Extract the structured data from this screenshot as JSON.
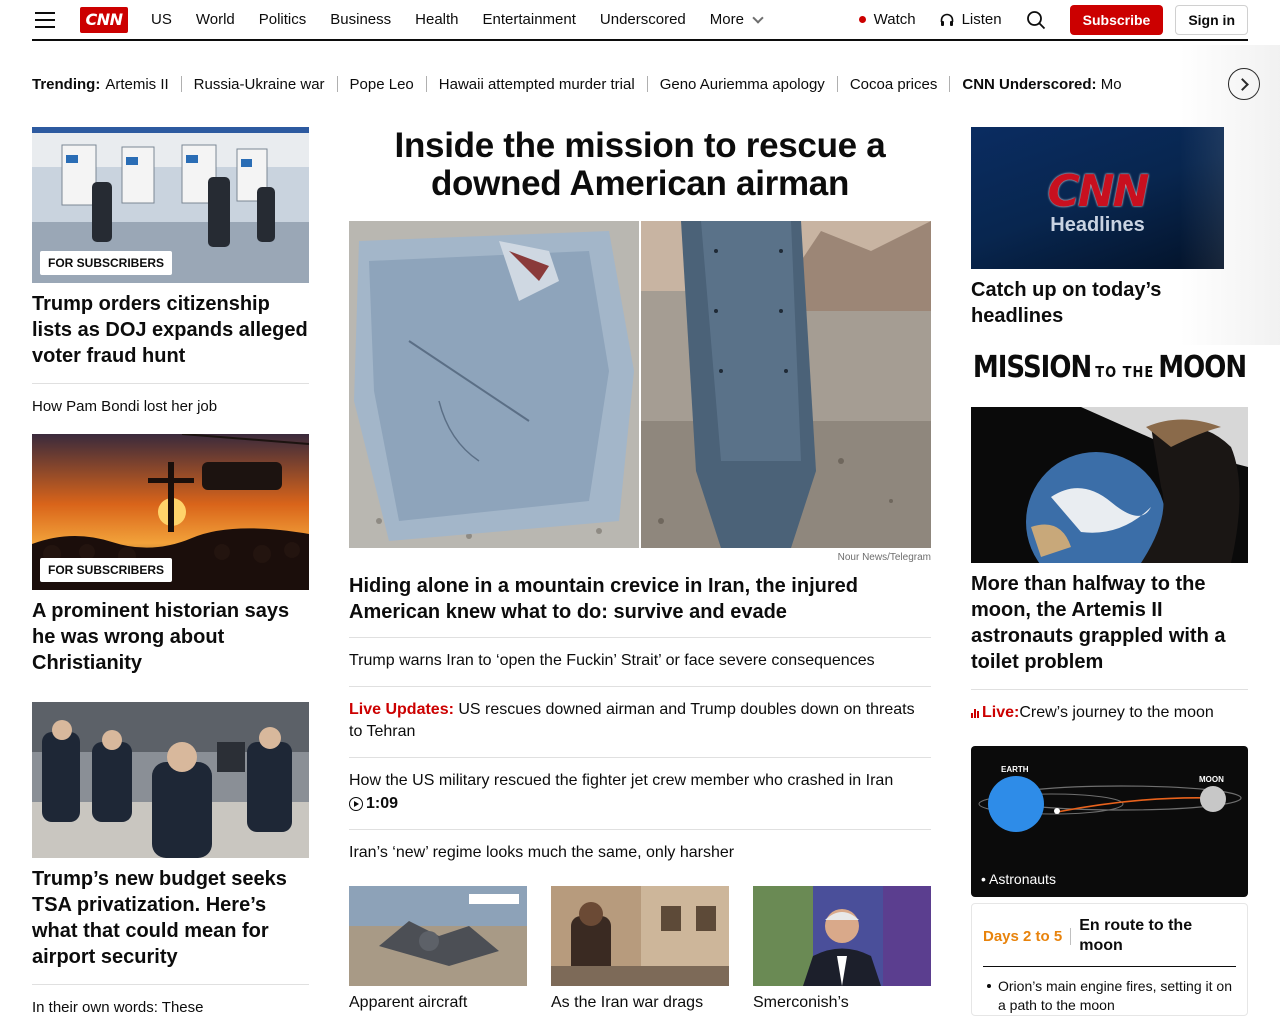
{
  "header": {
    "logo": "CNN",
    "nav": [
      "US",
      "World",
      "Politics",
      "Business",
      "Health",
      "Entertainment",
      "Underscored"
    ],
    "more_label": "More",
    "watch_label": "Watch",
    "listen_label": "Listen",
    "subscribe_label": "Subscribe",
    "signin_label": "Sign in"
  },
  "trending": {
    "label": "Trending:",
    "items": [
      "Artemis II",
      "Russia-Ukraine war",
      "Pope Leo",
      "Hawaii attempted murder trial",
      "Geno Auriemma apology",
      "Cocoa prices"
    ],
    "underscored_label": "CNN Underscored:",
    "underscored_text": "Mo"
  },
  "left": {
    "card1": {
      "badge": "FOR SUBSCRIBERS",
      "headline": "Trump orders citizenship lists as DOJ expands alleged voter fraud hunt"
    },
    "link1": "How Pam Bondi lost her job",
    "card2": {
      "badge": "FOR SUBSCRIBERS",
      "headline": "A prominent historian says he was wrong about Christianity"
    },
    "card3": {
      "headline": "Trump’s new budget seeks TSA privatization. Here’s what that could mean for airport security"
    },
    "link2": "In their own words: These"
  },
  "center": {
    "title": "Inside the mission to rescue a downed American airman",
    "credit": "Nour News/Telegram",
    "headline": "Hiding alone in a mountain crevice in Iran, the injured American knew what to do: survive and evade",
    "items": [
      {
        "text": "Trump warns Iran to ‘open the Fuckin’ Strait’ or face severe consequences"
      },
      {
        "live": "Live Updates:",
        "text": " US rescues downed airman and Trump doubles down on threats to Tehran"
      },
      {
        "text": "How the US military rescued the fighter jet crew member who crashed in Iran ",
        "duration": "1:09"
      },
      {
        "text": "Iran’s ‘new’ regime looks much the same, only harsher"
      }
    ],
    "thumbs": [
      "Apparent aircraft",
      "As the Iran war drags",
      "Smerconish’s"
    ]
  },
  "right": {
    "headlines_tile": {
      "brand": "CNN",
      "word": "Headlines"
    },
    "headlines_caption": "Catch up on today’s headlines",
    "mission": {
      "a": "MISSION",
      "b": "TO THE",
      "c": "MOON"
    },
    "moon_headline": "More than halfway to the moon, the Artemis II astronauts grappled with a toilet problem",
    "live_label": "Live:",
    "live_text": " Crew’s journey to the moon",
    "orbit": {
      "earth": "EARTH",
      "moon": "MOON",
      "caption": "• Astronauts"
    },
    "days": {
      "label": "Days 2 to 5",
      "title": "En route to the moon",
      "item": "Orion’s main engine fires, setting it on a path to the moon"
    }
  },
  "colors": {
    "brand_red": "#cc0000",
    "accent_orange": "#e8830c",
    "text": "#0c0c0c"
  }
}
